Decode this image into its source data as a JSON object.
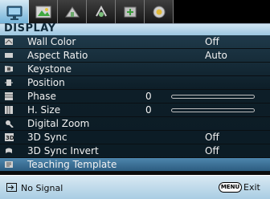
{
  "tabs": [
    {
      "icon": "display-settings-icon",
      "active": true
    },
    {
      "icon": "picture-icon",
      "active": false
    },
    {
      "icon": "basic-settings-icon",
      "active": false
    },
    {
      "icon": "advanced-settings-icon",
      "active": false
    },
    {
      "icon": "system-settings-icon",
      "active": false
    },
    {
      "icon": "information-icon",
      "active": false
    }
  ],
  "title": "DISPLAY",
  "rows": [
    {
      "icon": "wall-color-icon",
      "label": "Wall Color",
      "value": "Off"
    },
    {
      "icon": "aspect-ratio-icon",
      "label": "Aspect Ratio",
      "value": "Auto"
    },
    {
      "icon": "keystone-icon",
      "label": "Keystone",
      "value": ""
    },
    {
      "icon": "position-icon",
      "label": "Position",
      "value": ""
    },
    {
      "icon": "phase-icon",
      "label": "Phase",
      "number": "0",
      "slider": 0
    },
    {
      "icon": "h-size-icon",
      "label": "H. Size",
      "number": "0",
      "slider": 0
    },
    {
      "icon": "digital-zoom-icon",
      "label": "Digital Zoom",
      "value": ""
    },
    {
      "icon": "3d-sync-icon",
      "label": "3D Sync",
      "value": "Off"
    },
    {
      "icon": "3d-sync-invert-icon",
      "label": "3D Sync Invert",
      "value": "Off"
    },
    {
      "icon": "teaching-template-icon",
      "label": "Teaching Template",
      "value": "",
      "selected": true
    }
  ],
  "status": {
    "source_label": "No Signal",
    "menu_button": "MENU",
    "exit_label": "Exit"
  },
  "colors": {
    "accent_light": "#cfe4f1",
    "selected_row": "#3f78a0",
    "list_bg": "#0c1b24"
  }
}
